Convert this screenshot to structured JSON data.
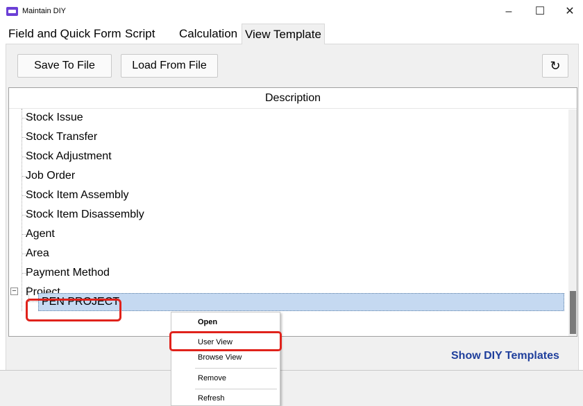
{
  "window": {
    "title": "Maintain DIY",
    "minimize": "–",
    "maximize": "☐",
    "close": "✕"
  },
  "tabs": [
    {
      "label": "Field and Quick Form"
    },
    {
      "label": "Script"
    },
    {
      "label": "Calculation"
    },
    {
      "label": "View Template",
      "active": true
    }
  ],
  "toolbar": {
    "save_label": "Save To File",
    "load_label": "Load From File",
    "refresh_icon": "↻"
  },
  "tree": {
    "header": "Description",
    "items": [
      {
        "label": "Stock Issue"
      },
      {
        "label": "Stock Transfer"
      },
      {
        "label": "Stock Adjustment"
      },
      {
        "label": "Job Order"
      },
      {
        "label": "Stock Item Assembly"
      },
      {
        "label": "Stock Item Disassembly"
      },
      {
        "label": "Agent"
      },
      {
        "label": "Area"
      },
      {
        "label": "Payment Method"
      }
    ],
    "expander": "−",
    "project": {
      "label": "Project",
      "child": "PEN PROJECT"
    }
  },
  "context_menu": {
    "items": [
      {
        "label": "Open"
      },
      {
        "label": "User View"
      },
      {
        "label": "Browse View"
      },
      {
        "label": "Remove"
      },
      {
        "label": "Refresh"
      }
    ]
  },
  "footer": {
    "link": "Show DIY Templates"
  },
  "colors": {
    "accent_link": "#1f3f9c",
    "selection": "#c5d9f1",
    "highlight_box": "#e0221b"
  }
}
